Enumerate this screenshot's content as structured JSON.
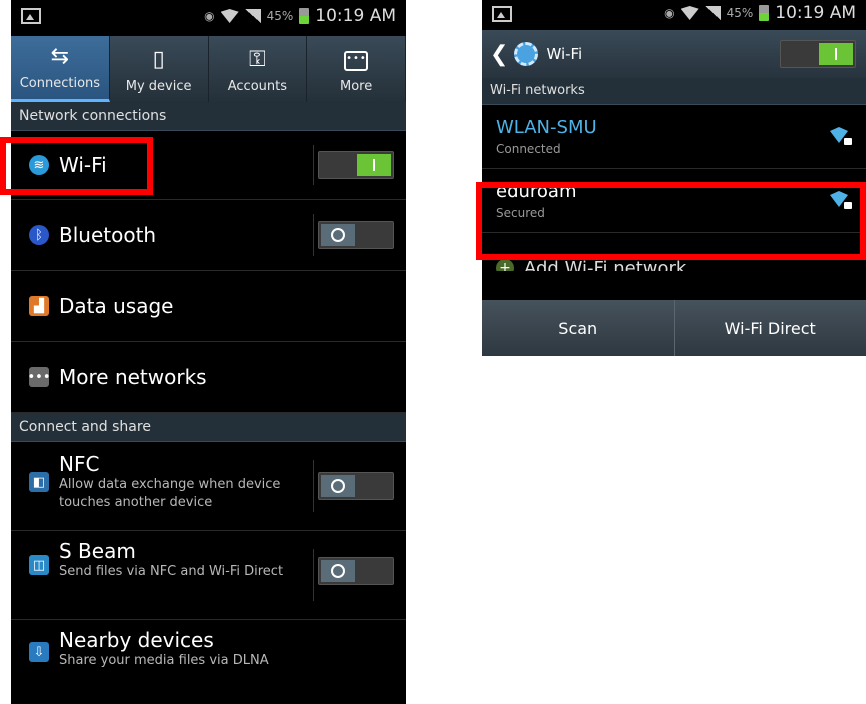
{
  "left": {
    "status": {
      "time": "10:19 AM",
      "battery": "45%"
    },
    "tabs": [
      {
        "label": "Connections",
        "icon": "connections-icon"
      },
      {
        "label": "My device",
        "icon": "my-device-icon"
      },
      {
        "label": "Accounts",
        "icon": "accounts-icon"
      },
      {
        "label": "More",
        "icon": "more-icon"
      }
    ],
    "section_network": "Network connections",
    "wifi_label": "Wi-Fi",
    "bluetooth_label": "Bluetooth",
    "data_usage_label": "Data usage",
    "more_networks_label": "More networks",
    "section_share": "Connect and share",
    "nfc": {
      "label": "NFC",
      "sub": "Allow data exchange when device touches another device"
    },
    "sbeam": {
      "label": "S Beam",
      "sub": "Send files via NFC and Wi-Fi Direct"
    },
    "nearby": {
      "label": "Nearby devices",
      "sub": "Share your media files via DLNA"
    }
  },
  "right": {
    "status": {
      "time": "10:19 AM",
      "battery": "45%"
    },
    "title": "Wi-Fi",
    "section": "Wi-Fi networks",
    "networks": [
      {
        "name": "WLAN-SMU",
        "status": "Connected"
      },
      {
        "name": "eduroam",
        "status": "Secured"
      }
    ],
    "add_network": "Add Wi-Fi network",
    "scan": "Scan",
    "wifi_direct": "Wi-Fi Direct"
  },
  "colors": {
    "highlight": "#ff0000",
    "toggle_on": "#6bc435",
    "accent": "#4fb2e6"
  }
}
